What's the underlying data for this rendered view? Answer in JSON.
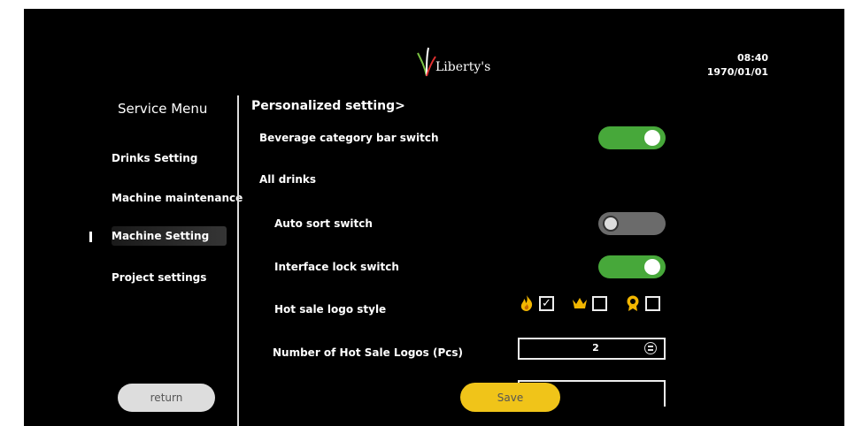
{
  "header": {
    "brand": "Liberty's",
    "time": "08:40",
    "date": "1970/01/01"
  },
  "sidebar": {
    "title": "Service Menu",
    "items": [
      {
        "label": "Drinks Setting"
      },
      {
        "label": "Machine maintenance"
      },
      {
        "label": "Machine Setting",
        "active": true
      },
      {
        "label": "Project settings"
      }
    ],
    "return_label": "return"
  },
  "content": {
    "section_title": "Personalized setting>",
    "beverage_bar": {
      "label": "Beverage category bar switch",
      "state": "on"
    },
    "all_drinks": {
      "label": "All drinks"
    },
    "auto_sort": {
      "label": "Auto sort switch",
      "state": "off"
    },
    "interface_lock": {
      "label": "Interface lock switch",
      "state": "on"
    },
    "hot_sale_style": {
      "label": "Hot sale logo style",
      "options": [
        {
          "icon": "flame-icon",
          "checked": true
        },
        {
          "icon": "crown-icon",
          "checked": false
        },
        {
          "icon": "badge-icon",
          "checked": false
        }
      ]
    },
    "hot_sale_count": {
      "label": "Number of Hot Sale Logos (Pcs)",
      "value": "2"
    },
    "save_label": "Save"
  },
  "colors": {
    "toggle_on": "#47a83a",
    "toggle_off": "#6b6b6b",
    "save": "#f0c419",
    "icon_gold": "#f2b600"
  }
}
